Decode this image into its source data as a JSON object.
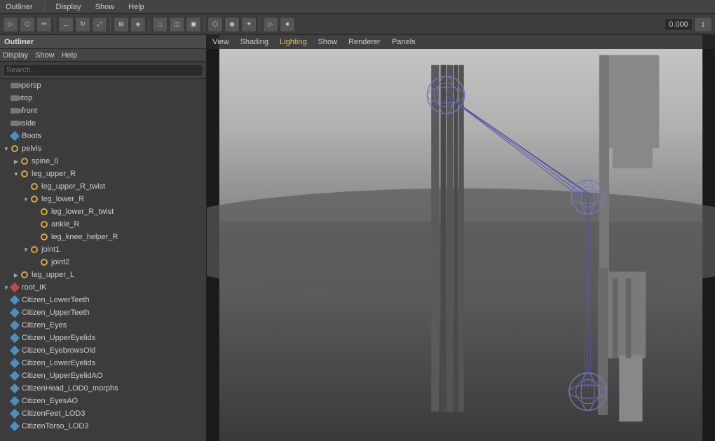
{
  "app": {
    "title": "Outliner"
  },
  "menubar": {
    "items": [
      "Display",
      "Show",
      "Help"
    ]
  },
  "outliner": {
    "title": "Outliner",
    "menu_items": [
      "Display",
      "Show",
      "Help"
    ],
    "search_placeholder": "Search...",
    "tree_items": [
      {
        "id": "persp",
        "label": "persp",
        "indent": 0,
        "type": "camera",
        "arrow": ""
      },
      {
        "id": "top",
        "label": "top",
        "indent": 0,
        "type": "camera",
        "arrow": ""
      },
      {
        "id": "front",
        "label": "front",
        "indent": 0,
        "type": "camera",
        "arrow": ""
      },
      {
        "id": "side",
        "label": "side",
        "indent": 0,
        "type": "camera",
        "arrow": ""
      },
      {
        "id": "Boots",
        "label": "Boots",
        "indent": 0,
        "type": "mesh",
        "arrow": ""
      },
      {
        "id": "pelvis",
        "label": "pelvis",
        "indent": 0,
        "type": "joint",
        "arrow": "▼"
      },
      {
        "id": "spine_0",
        "label": "spine_0",
        "indent": 1,
        "type": "joint",
        "arrow": "▶"
      },
      {
        "id": "leg_upper_R",
        "label": "leg_upper_R",
        "indent": 1,
        "type": "joint",
        "arrow": "▼"
      },
      {
        "id": "leg_upper_R_twist",
        "label": "leg_upper_R_twist",
        "indent": 2,
        "type": "joint",
        "arrow": ""
      },
      {
        "id": "leg_lower_R",
        "label": "leg_lower_R",
        "indent": 2,
        "type": "joint",
        "arrow": "▼"
      },
      {
        "id": "leg_lower_R_twist",
        "label": "leg_lower_R_twist",
        "indent": 3,
        "type": "joint",
        "arrow": ""
      },
      {
        "id": "ankle_R",
        "label": "ankle_R",
        "indent": 3,
        "type": "joint",
        "arrow": ""
      },
      {
        "id": "leg_knee_helper_R",
        "label": "leg_knee_helper_R",
        "indent": 3,
        "type": "joint",
        "arrow": ""
      },
      {
        "id": "joint1",
        "label": "joint1",
        "indent": 2,
        "type": "joint",
        "arrow": "▼"
      },
      {
        "id": "joint2",
        "label": "joint2",
        "indent": 3,
        "type": "joint",
        "arrow": ""
      },
      {
        "id": "leg_upper_L",
        "label": "leg_upper_L",
        "indent": 1,
        "type": "joint",
        "arrow": "▶"
      },
      {
        "id": "root_IK",
        "label": "root_IK",
        "indent": 0,
        "type": "ik",
        "arrow": "▼"
      },
      {
        "id": "Citizen_LowerTeeth",
        "label": "Citizen_LowerTeeth",
        "indent": 0,
        "type": "mesh",
        "arrow": ""
      },
      {
        "id": "Citizen_UpperTeeth",
        "label": "Citizen_UpperTeeth",
        "indent": 0,
        "type": "mesh",
        "arrow": ""
      },
      {
        "id": "Citizen_Eyes",
        "label": "Citizen_Eyes",
        "indent": 0,
        "type": "mesh",
        "arrow": ""
      },
      {
        "id": "Citizen_UpperEyelids",
        "label": "Citizen_UpperEyelids",
        "indent": 0,
        "type": "mesh",
        "arrow": ""
      },
      {
        "id": "Citizen_EyebrowsOld",
        "label": "Citizen_EyebrowsOld",
        "indent": 0,
        "type": "mesh",
        "arrow": ""
      },
      {
        "id": "Citizen_LowerEyelids",
        "label": "Citizen_LowerEyelids",
        "indent": 0,
        "type": "mesh",
        "arrow": ""
      },
      {
        "id": "Citizen_UpperEyelidAO",
        "label": "Citizen_UpperEyelidAO",
        "indent": 0,
        "type": "mesh",
        "arrow": ""
      },
      {
        "id": "CitizenHead_LOD0_morphs",
        "label": "CitizenHead_LOD0_morphs",
        "indent": 0,
        "type": "mesh",
        "arrow": ""
      },
      {
        "id": "Citizen_EyesAO",
        "label": "Citizen_EyesAO",
        "indent": 0,
        "type": "mesh",
        "arrow": ""
      },
      {
        "id": "CitizenFeet_LOD3",
        "label": "CitizenFeet_LOD3",
        "indent": 0,
        "type": "mesh",
        "arrow": ""
      },
      {
        "id": "CitizenTorso_LOD3",
        "label": "CitizenTorso_LOD3",
        "indent": 0,
        "type": "mesh",
        "arrow": ""
      }
    ]
  },
  "viewport": {
    "menu_items": [
      "View",
      "Shading",
      "Lighting",
      "Show",
      "Renderer",
      "Panels"
    ],
    "active_menu": "Lighting"
  },
  "toolbar": {
    "value": "0.000"
  }
}
